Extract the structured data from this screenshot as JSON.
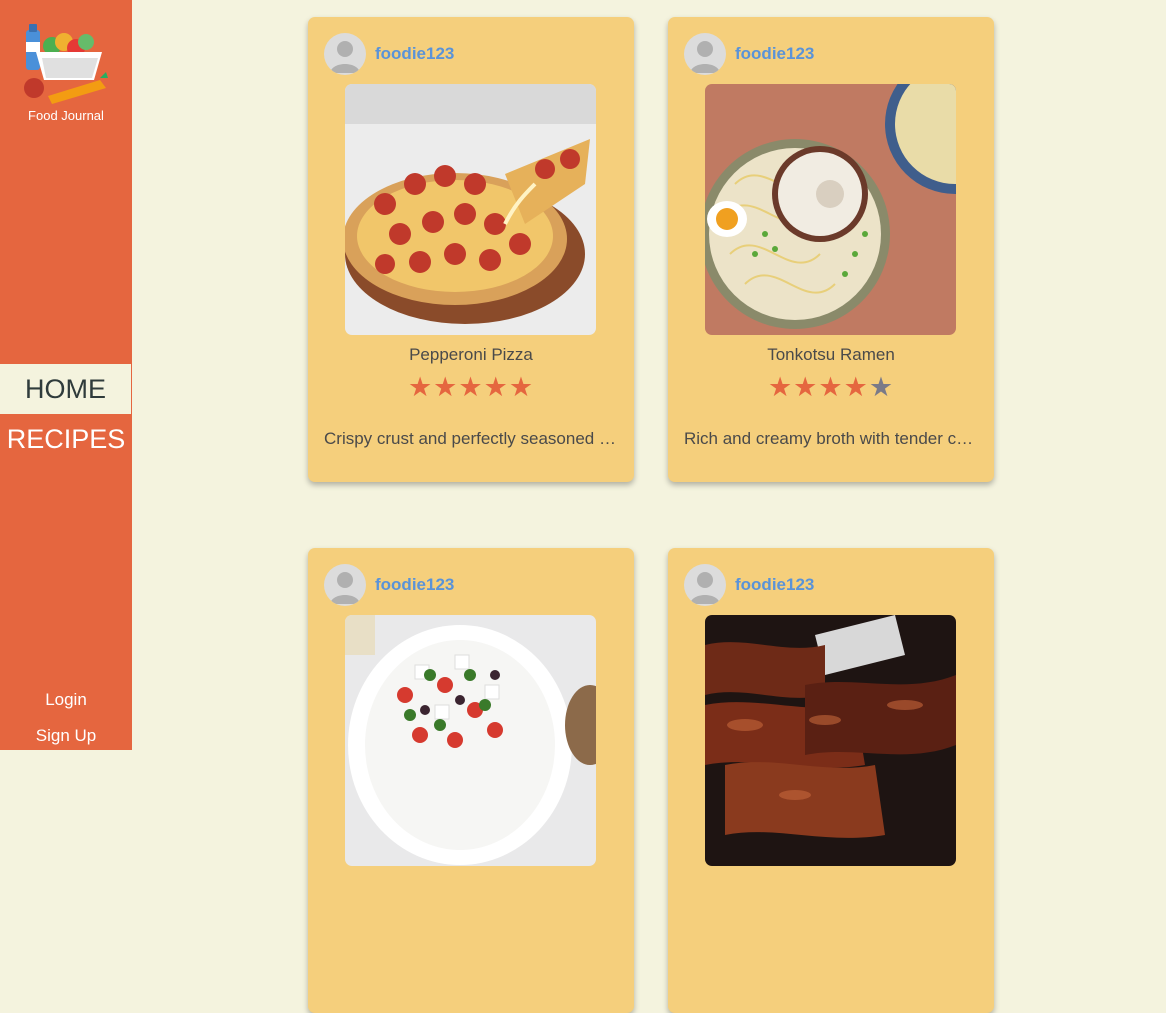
{
  "app": {
    "title": "Food Journal",
    "accent_color": "#e5663f",
    "background_color": "#f4f3de",
    "card_color": "#f5cf7c"
  },
  "sidebar": {
    "logo_icon": "food-basket-icon",
    "nav": [
      {
        "label": "HOME",
        "active": true
      },
      {
        "label": "RECIPES",
        "active": false
      }
    ],
    "auth": {
      "login": "Login",
      "signup": "Sign Up"
    }
  },
  "posts": [
    {
      "user": "foodie123",
      "dish": "Pepperoni Pizza",
      "rating": 5,
      "max_rating": 5,
      "description": "Crispy crust and perfectly seasoned pepperoni",
      "photo": "pizza-photo"
    },
    {
      "user": "foodie123",
      "dish": "Tonkotsu Ramen",
      "rating": 4,
      "max_rating": 5,
      "description": "Rich and creamy broth with tender chashu pork",
      "photo": "ramen-photo"
    },
    {
      "user": "foodie123",
      "dish": "",
      "rating": null,
      "description": "",
      "photo": "greek-salad-photo"
    },
    {
      "user": "foodie123",
      "dish": "",
      "rating": null,
      "description": "",
      "photo": "bbq-ribs-photo"
    }
  ]
}
